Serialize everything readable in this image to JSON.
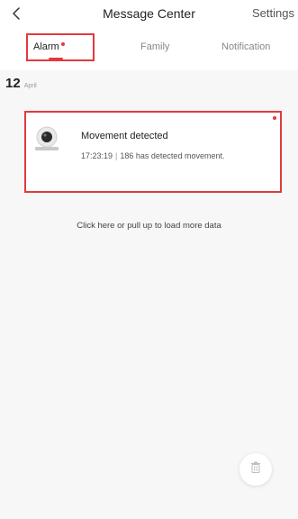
{
  "header": {
    "title": "Message Center",
    "settings_label": "Settings"
  },
  "tabs": [
    {
      "label": "Alarm",
      "active": true,
      "has_unread": true
    },
    {
      "label": "Family",
      "active": false
    },
    {
      "label": "Notification",
      "active": false
    }
  ],
  "date_group": {
    "day": "12",
    "month": "April"
  },
  "messages": [
    {
      "title": "Movement detected",
      "time": "17:23:19",
      "separator": "|",
      "text": "186 has detected movement.",
      "unread": true,
      "icon": "camera-icon"
    }
  ],
  "load_more_label": "Click here or pull up to load more data",
  "actions": {
    "delete_icon": "trash-icon"
  },
  "colors": {
    "accent": "#e03a3e",
    "background": "#f7f7f7"
  }
}
